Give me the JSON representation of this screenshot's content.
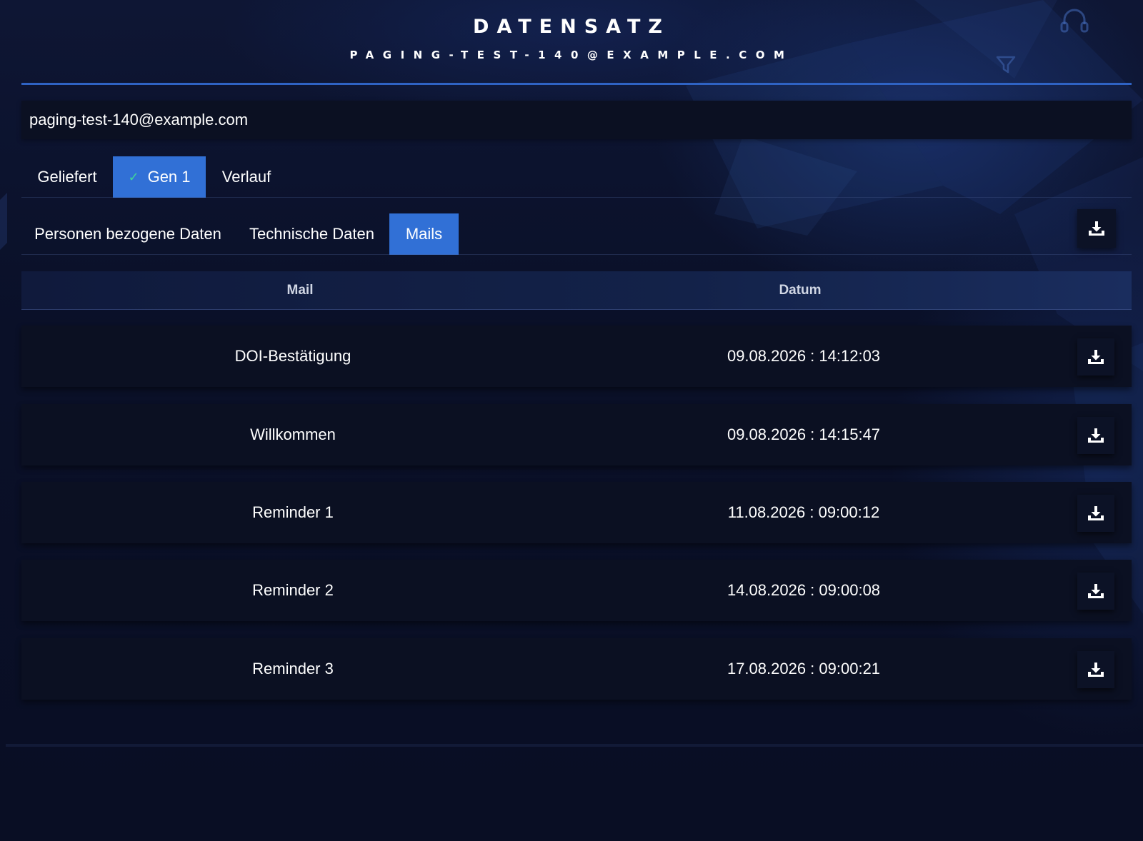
{
  "header": {
    "title": "DATENSATZ",
    "subtitle": "PAGING-TEST-140@EXAMPLE.COM"
  },
  "record": {
    "email": "paging-test-140@example.com"
  },
  "gen_tabs": [
    {
      "label": "Geliefert",
      "active": false
    },
    {
      "label": "Gen 1",
      "active": true
    },
    {
      "label": "Verlauf",
      "active": false
    }
  ],
  "sub_tabs": [
    {
      "label": "Personen bezogene Daten",
      "active": false
    },
    {
      "label": "Technische Daten",
      "active": false
    },
    {
      "label": "Mails",
      "active": true
    }
  ],
  "table": {
    "columns": [
      "Mail",
      "Datum"
    ],
    "rows": [
      {
        "mail": "DOI-Bestätigung",
        "datum": "09.08.2026 : 14:12:03"
      },
      {
        "mail": "Willkommen",
        "datum": "09.08.2026 : 14:15:47"
      },
      {
        "mail": "Reminder 1",
        "datum": "11.08.2026 : 09:00:12"
      },
      {
        "mail": "Reminder 2",
        "datum": "14.08.2026 : 09:00:08"
      },
      {
        "mail": "Reminder 3",
        "datum": "17.08.2026 : 09:00:21"
      }
    ]
  },
  "icons": {
    "download": "download-icon",
    "check": "check-icon",
    "headset": "headset-icon",
    "filter": "filter-icon"
  },
  "colors": {
    "accent": "#3170d6",
    "check": "#3fd39a",
    "background": "#0a0f24"
  }
}
